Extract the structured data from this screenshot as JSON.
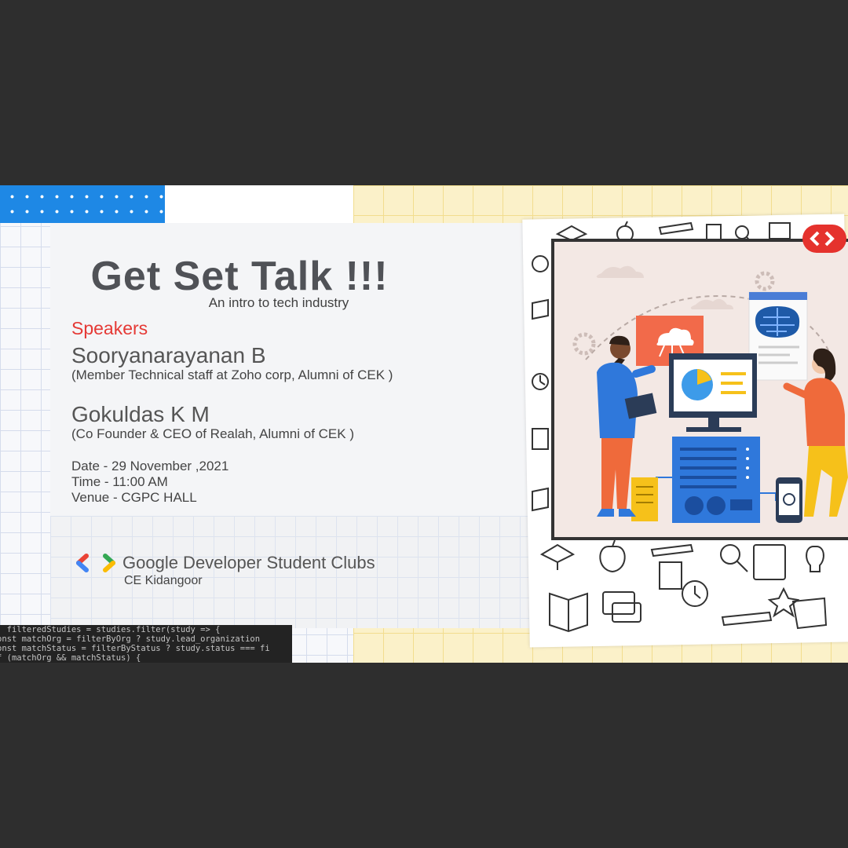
{
  "event": {
    "title": "Get Set Talk !!!",
    "subtitle": "An intro to tech industry",
    "speakers_label": "Speakers",
    "speakers": [
      {
        "name": "Sooryanarayanan B",
        "description": "(Member Technical staff at Zoho corp, Alumni of CEK )"
      },
      {
        "name": "Gokuldas K M",
        "description": "(Co Founder & CEO of Realah, Alumni of CEK )"
      }
    ],
    "date": "Date - 29 November ,2021",
    "time": "Time - 11:00 AM",
    "venue": "Venue - CGPC HALL"
  },
  "org": {
    "name": "Google Developer Student Clubs",
    "chapter": "CE Kidangoor",
    "logo_colors": {
      "blue": "#4285F4",
      "red": "#EA4335",
      "green": "#34A853",
      "yellow": "#FBBC04"
    }
  },
  "code_snippet": [
    "  filteredStudies = studies.filter(study => {",
    "onst matchOrg = filterByOrg ? study.lead_organization",
    "onst matchStatus = filterByStatus ? study.status === fi",
    "f (matchOrg && matchStatus) {"
  ],
  "colors": {
    "accent_red": "#e53935",
    "accent_blue": "#1e88e5",
    "text_gray": "#505257"
  }
}
